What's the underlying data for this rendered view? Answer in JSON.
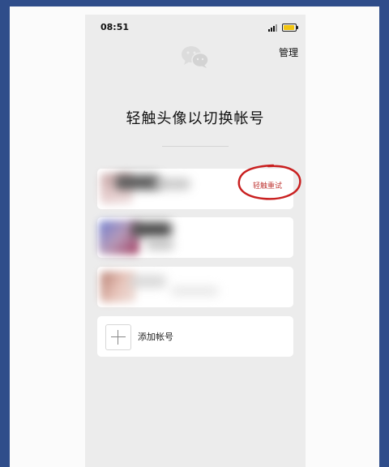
{
  "status_bar": {
    "time": "08:51",
    "signal_icon": "signal-icon",
    "battery_icon": "battery-icon",
    "battery_color": "#f1c40f"
  },
  "header": {
    "logo_icon": "wechat-logo-icon",
    "manage_label": "管理"
  },
  "main": {
    "title": "轻触头像以切换帐号",
    "accounts": [
      {
        "status": "轻触重试",
        "status_color": "#c03b38"
      },
      {
        "status": ""
      },
      {
        "status": ""
      }
    ],
    "add_account_label": "添加帐号",
    "add_icon": "plus-icon"
  },
  "annotation": {
    "shape": "hand-drawn circle",
    "color": "#c92020"
  }
}
